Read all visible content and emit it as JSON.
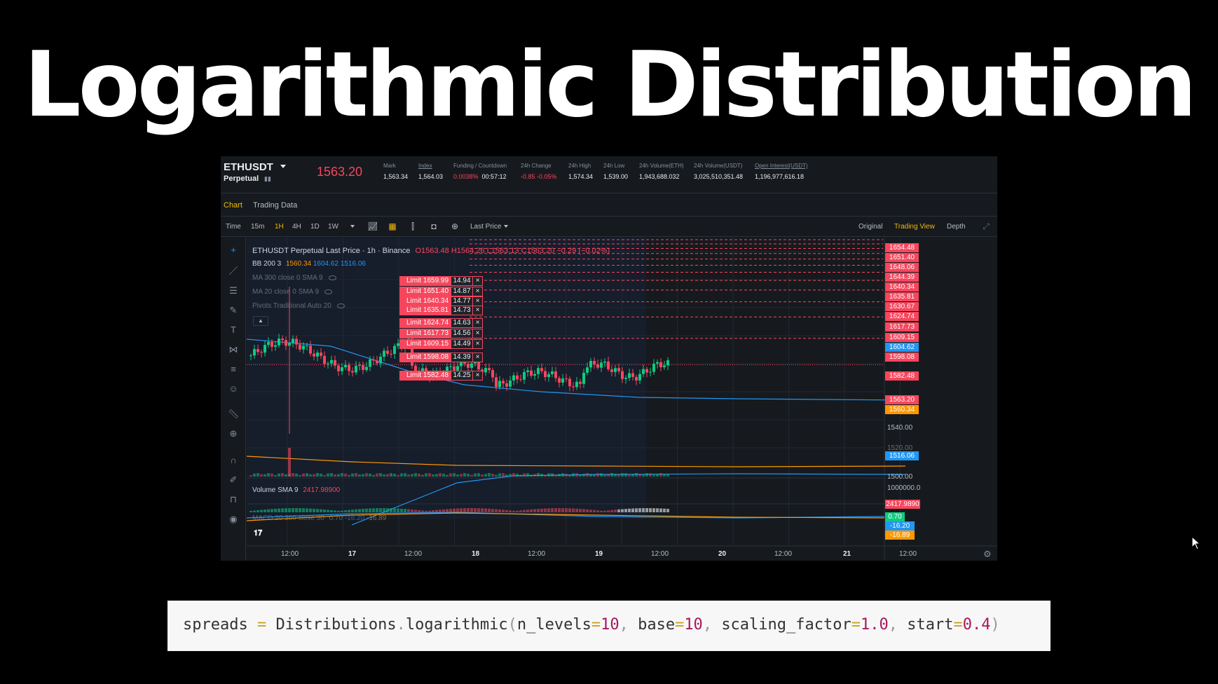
{
  "slide": {
    "title": "Logarithmic Distribution"
  },
  "ticker": {
    "symbol": "ETHUSDT",
    "contract": "Perpetual",
    "last_price": "1563.20",
    "stats": [
      {
        "label": "Mark",
        "value": "1,563.34",
        "underline": false
      },
      {
        "label": "Index",
        "value": "1,564.03",
        "underline": true
      },
      {
        "label": "Funding / Countdown",
        "value": "0.0038%",
        "value2": "00:57:12",
        "underline": false
      },
      {
        "label": "24h Change",
        "value": "-0.85 -0.05%",
        "underline": false
      },
      {
        "label": "24h High",
        "value": "1,574.34",
        "underline": false
      },
      {
        "label": "24h Low",
        "value": "1,539.00",
        "underline": false
      },
      {
        "label": "24h Volume(ETH)",
        "value": "1,943,688.032",
        "underline": false
      },
      {
        "label": "24h Volume(USDT)",
        "value": "3,025,510,351.48",
        "underline": false
      },
      {
        "label": "Open Interest(USDT)",
        "value": "1,196,977,616.18",
        "underline": true
      }
    ]
  },
  "tabs": {
    "chart": "Chart",
    "trading_data": "Trading Data"
  },
  "toolbar": {
    "time": "Time",
    "intervals": [
      "15m",
      "1H",
      "4H",
      "1D",
      "1W"
    ],
    "price_type": "Last Price",
    "views": [
      "Original",
      "Trading View",
      "Depth"
    ]
  },
  "legend": {
    "title": "ETHUSDT Perpetual Last Price · 1h · Binance",
    "ohlc_o": "O1563.48",
    "ohlc_h": "H1564.26",
    "ohlc_l": "L1563.13",
    "ohlc_c": "C1563.20",
    "ohlc_change": "−0.29 (−0.02%)",
    "bb_label": "BB 200 3",
    "bb_mid": "1560.34",
    "bb_upper": "1604.62",
    "bb_lower": "1516.06",
    "ma300": "MA 300 close 0 SMA 9",
    "ma20": "MA 20 close 0 SMA 9",
    "pivots": "Pivots Traditional Auto 20",
    "volume_label": "Volume SMA 9",
    "volume_value": "2417.98900",
    "macd_label": "MACD 20 300 close 30",
    "macd_values": [
      "0.70",
      "-16.20",
      "-16.89"
    ]
  },
  "orders": [
    {
      "label": "Limit 1659.99",
      "qty": "14.94",
      "price": 1659.99
    },
    {
      "label": "Limit 1651.40",
      "qty": "14.87",
      "price": 1651.4
    },
    {
      "label": "Limit 1640.34",
      "qty": "14.77",
      "price": 1640.34
    },
    {
      "label": "Limit 1635.81",
      "qty": "14.73",
      "price": 1635.81
    },
    {
      "label": "Limit 1624.74",
      "qty": "14.63",
      "price": 1624.74
    },
    {
      "label": "Limit 1617.73",
      "qty": "14.56",
      "price": 1617.73
    },
    {
      "label": "Limit 1609.15",
      "qty": "14.49",
      "price": 1609.15
    },
    {
      "label": "Limit 1598.08",
      "qty": "14.39",
      "price": 1598.08
    },
    {
      "label": "Limit 1582.48",
      "qty": "14.25",
      "price": 1582.48
    }
  ],
  "price_axis": {
    "ylim": [
      1500,
      1656
    ],
    "order_levels": [
      "1654.48",
      "1651.40",
      "1648.06",
      "1644.39",
      "1640.34",
      "1635.81",
      "1630.67",
      "1624.74",
      "1617.73",
      "1609.15",
      "1598.08",
      "1582.48"
    ],
    "bb_upper_label": "1604.62",
    "current_label": "1563.20",
    "bb_mid_label": "1560.34",
    "bb_lower_label": "1516.06",
    "ticks": [
      "1540.00",
      "1520.00",
      "1500.00"
    ],
    "volume_axis": "1000000.0",
    "volume_label": "2417.9890",
    "macd_labels": [
      "0.70",
      "-16.20",
      "-16.89"
    ]
  },
  "time_axis": [
    "12:00",
    "17",
    "12:00",
    "18",
    "12:00",
    "19",
    "12:00",
    "20",
    "12:00",
    "21",
    "12:00"
  ],
  "colors": {
    "up": "#0ecb81",
    "down": "#f6465d",
    "accent": "#f0b90b",
    "bb_mid": "#ff9800",
    "bb_band": "#2196f3"
  },
  "code": {
    "var": "spreads",
    "op": "=",
    "obj": "Distributions",
    "func": "logarithmic",
    "args": [
      {
        "name": "n_levels",
        "value": "10"
      },
      {
        "name": "base",
        "value": "10"
      },
      {
        "name": "scaling_factor",
        "value": "1.0"
      },
      {
        "name": "start",
        "value": "0.4"
      }
    ]
  }
}
